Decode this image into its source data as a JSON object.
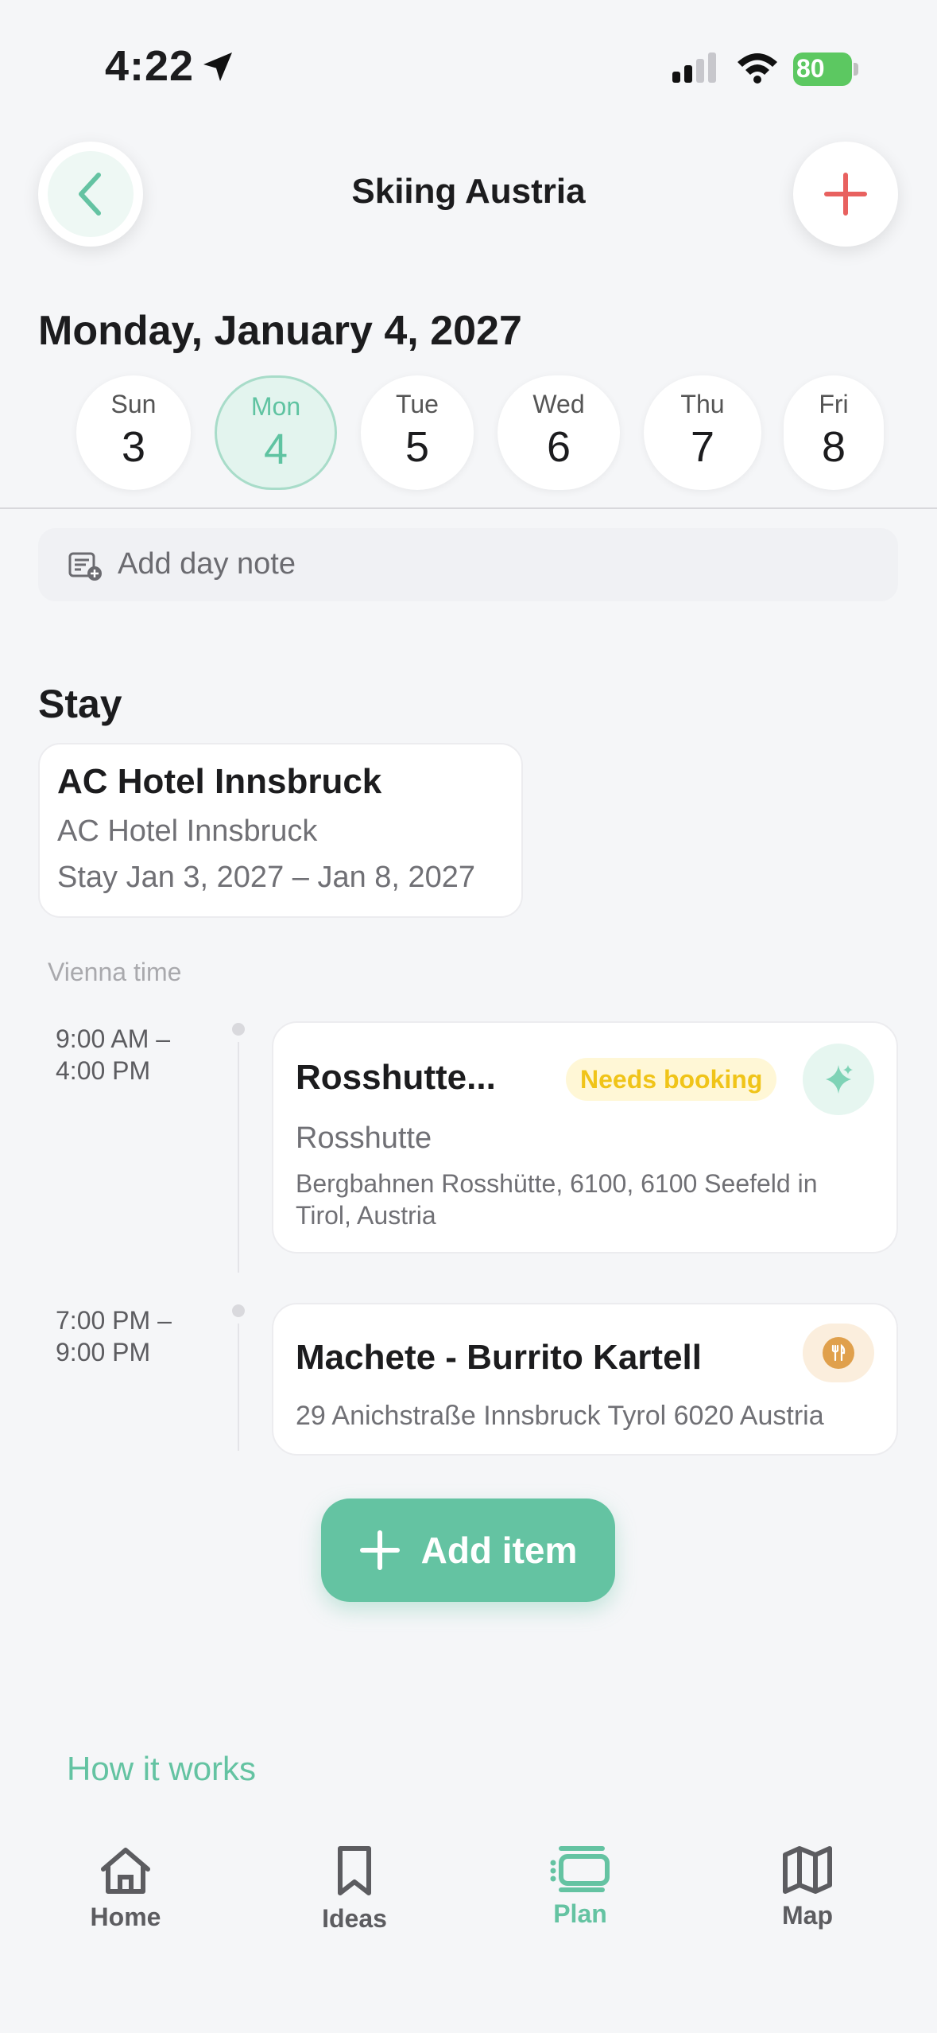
{
  "status_bar": {
    "time": "4:22",
    "battery": "80"
  },
  "header": {
    "title": "Skiing Austria",
    "back_icon": "chevron-left-icon",
    "add_icon": "plus-icon"
  },
  "date_title": "Monday, January 4, 2027",
  "days": [
    {
      "name": "Sun",
      "num": "3",
      "selected": false
    },
    {
      "name": "Mon",
      "num": "4",
      "selected": true
    },
    {
      "name": "Tue",
      "num": "5",
      "selected": false
    },
    {
      "name": "Wed",
      "num": "6",
      "selected": false
    },
    {
      "name": "Thu",
      "num": "7",
      "selected": false
    },
    {
      "name": "Fri",
      "num": "8",
      "selected": false
    }
  ],
  "day_note": {
    "label": "Add day note"
  },
  "stay": {
    "heading": "Stay",
    "name": "AC Hotel Innsbruck",
    "subtitle": "AC Hotel Innsbruck",
    "dates": "Stay Jan 3, 2027 – Jan 8, 2027"
  },
  "timezone": "Vienna time",
  "events": [
    {
      "time_start": "9:00 AM –",
      "time_end": "4:00 PM",
      "title": "Rosshutte...",
      "badge": "Needs booking",
      "subtitle": "Rosshutte",
      "address": "Bergbahnen Rosshütte, 6100, 6100 Seefeld in Tirol, Austria",
      "icon": "sparkle-icon"
    },
    {
      "time_start": "7:00 PM –",
      "time_end": "9:00 PM",
      "title": "Machete - Burrito Kartell",
      "address": "29 Anichstraße Innsbruck Tyrol 6020 Austria",
      "icon": "utensils-icon"
    }
  ],
  "add_item": {
    "label": "Add item"
  },
  "how_it_works": "How it works",
  "tabs": [
    {
      "label": "Home",
      "icon": "home-icon",
      "active": false
    },
    {
      "label": "Ideas",
      "icon": "bookmark-icon",
      "active": false
    },
    {
      "label": "Plan",
      "icon": "plan-icon",
      "active": true
    },
    {
      "label": "Map",
      "icon": "map-icon",
      "active": false
    }
  ],
  "colors": {
    "accent": "#64c3a2",
    "badge_text": "#f0c419",
    "plus": "#e8615f",
    "food": "#e0a04c"
  }
}
